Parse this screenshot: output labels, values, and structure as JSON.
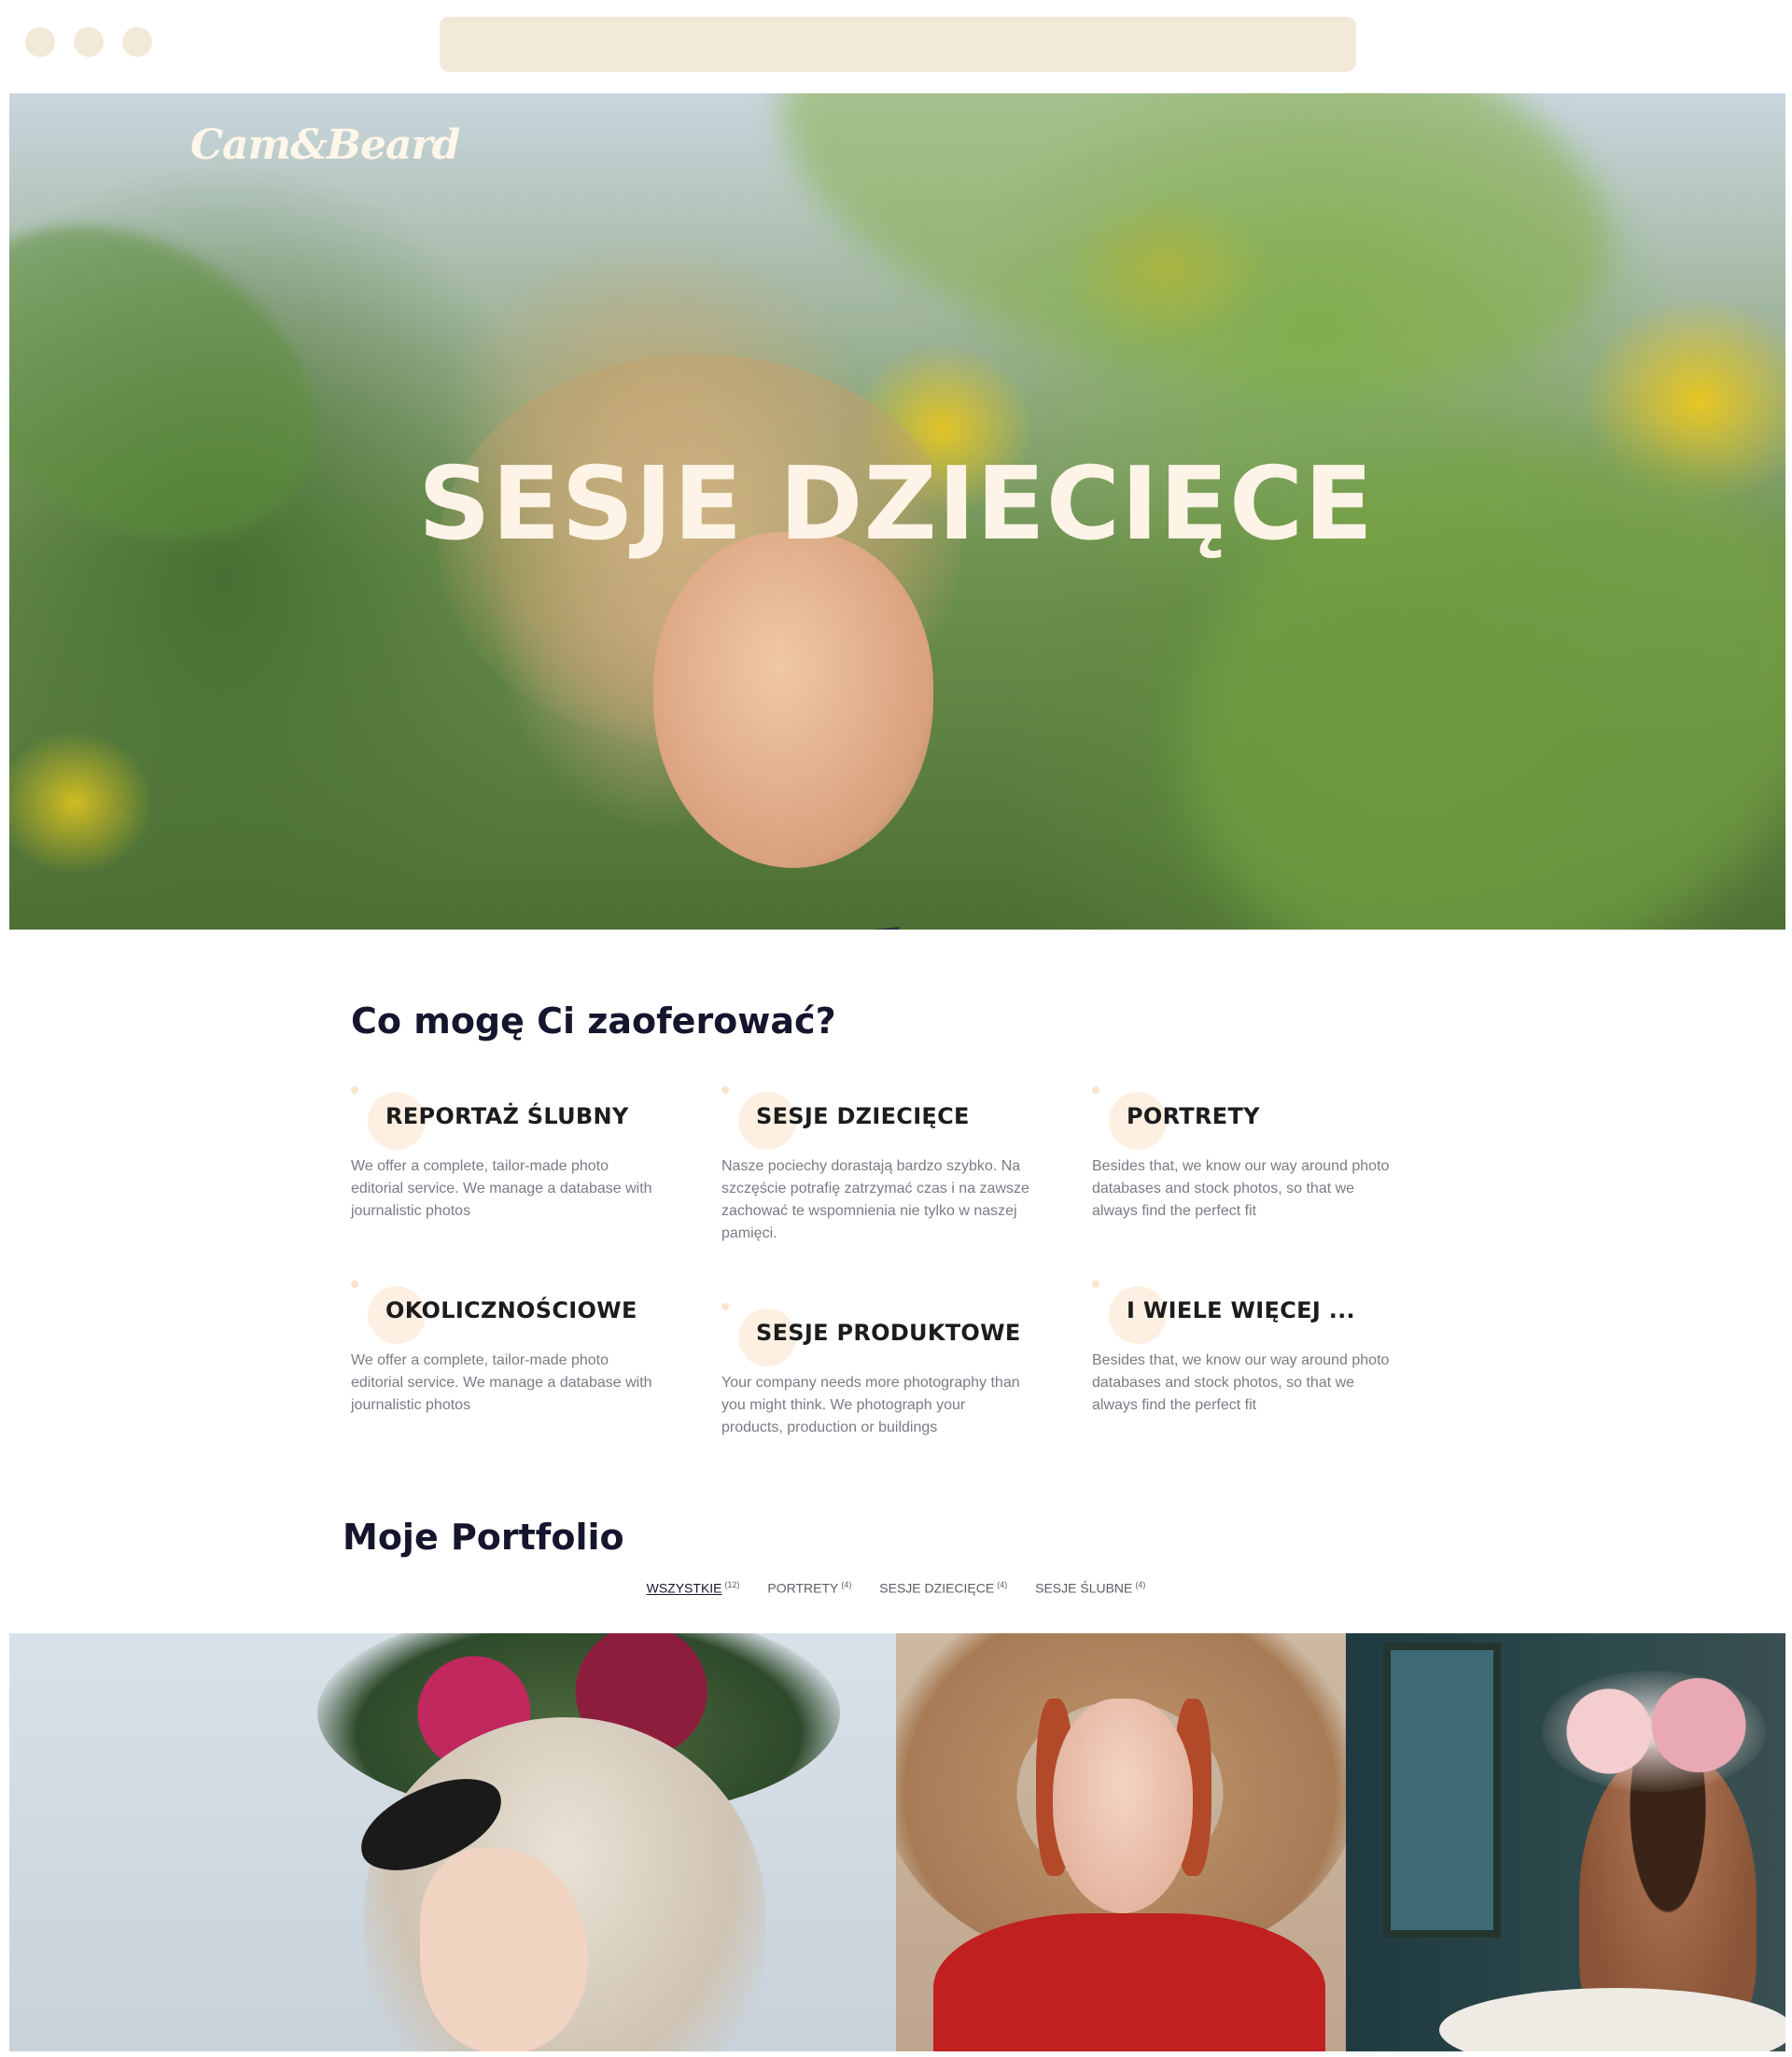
{
  "browser": {
    "url": ""
  },
  "hero": {
    "logo": "Cam&Beard",
    "title": "SESJE DZIECIĘCE"
  },
  "services": {
    "heading": "Co mogę Ci zaoferować?",
    "items": [
      {
        "title": "REPORTAŻ ŚLUBNY",
        "text": "We offer a complete, tailor-made photo editorial service. We manage a database with journalistic photos"
      },
      {
        "title": "SESJE DZIECIĘCE",
        "text": "Nasze pociechy dorastają bardzo szybko. Na szczęście potrafię zatrzymać czas i na zawsze zachować te wspomnienia nie tylko w naszej pamięci."
      },
      {
        "title": "PORTRETY",
        "text": "Besides that, we know our way around photo databases and stock photos, so that we always find the perfect fit"
      },
      {
        "title": "OKOLICZNOŚCIOWE",
        "text": "We offer a complete, tailor-made photo editorial service. We manage a database with journalistic photos"
      },
      {
        "title": "SESJE PRODUKTOWE",
        "text": "Your company needs more photography than you might think. We photograph your products, production or buildings"
      },
      {
        "title": "I WIELE WIĘCEJ ...",
        "text": "Besides that, we know our way around photo databases and stock photos, so that we always find the perfect fit"
      }
    ]
  },
  "portfolio": {
    "heading": "Moje Portfolio",
    "filters": [
      {
        "label": "WSZYSTKIE",
        "count": "(12)",
        "active": true
      },
      {
        "label": "PORTRETY",
        "count": "(4)",
        "active": false
      },
      {
        "label": "SESJE DZIECIĘCE",
        "count": "(4)",
        "active": false
      },
      {
        "label": "SESJE ŚLUBNE",
        "count": "(4)",
        "active": false
      }
    ]
  },
  "colors": {
    "accent_beige": "#f3e9d9",
    "heading_navy": "#15152e",
    "body_text": "#7d7a85",
    "hero_text": "#fdf3e6"
  }
}
